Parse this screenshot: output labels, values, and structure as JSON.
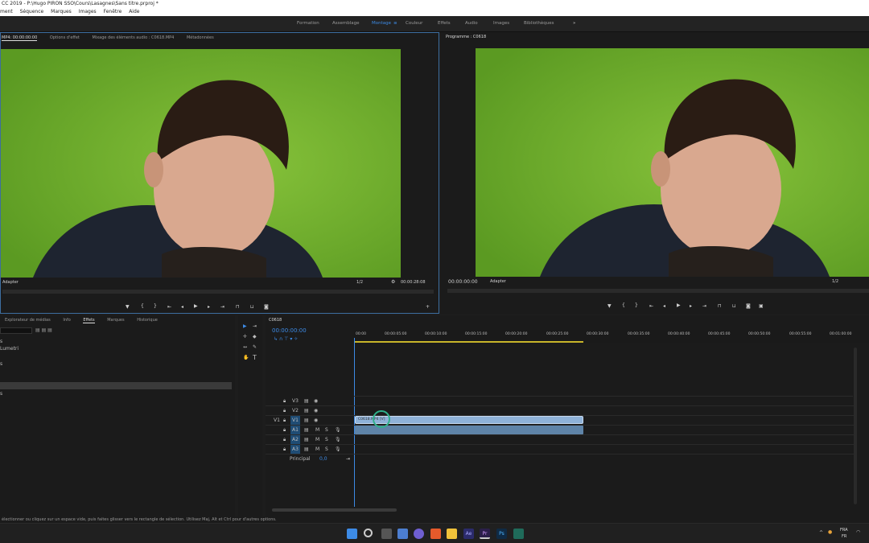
{
  "window": {
    "title": "CC 2019 - P:\\Hugo PIRON SSO\\Cours\\Lasagnes\\Sans titre.prproj *"
  },
  "menu": [
    "ment",
    "Séquence",
    "Marques",
    "Images",
    "Fenêtre",
    "Aide"
  ],
  "workspaces": [
    {
      "label": "Formation"
    },
    {
      "label": "Assemblage"
    },
    {
      "label": "Montage",
      "active": true
    },
    {
      "label": "Couleur"
    },
    {
      "label": "Effets"
    },
    {
      "label": "Audio"
    },
    {
      "label": "Images"
    },
    {
      "label": "Bibliothèques"
    },
    {
      "label": "»"
    }
  ],
  "source_monitor": {
    "tabs": [
      "MP4: 00:00:00:00",
      "Options d'effet",
      "Mixage des éléments audio : C0618.MP4",
      "Métadonnées"
    ],
    "fit": "Adapter",
    "resolution": "1/2",
    "duration": "00:00:28:08"
  },
  "program_monitor": {
    "tab": "Programme : C0618",
    "timecode": "00:00:00:00",
    "fit": "Adapter",
    "resolution": "1/2"
  },
  "project_panel": {
    "tabs": [
      "Explorateur de médias",
      "Info",
      "Effets",
      "Marques",
      "Historique"
    ],
    "list": [
      "s",
      "Lumetri",
      "s",
      "s"
    ]
  },
  "timeline": {
    "tab": "C0618",
    "timecode": "00:00:00:00",
    "ruler": [
      "00:00",
      "00:00:05:00",
      "00:00:10:00",
      "00:00:15:00",
      "00:00:20:00",
      "00:00:25:00",
      "00:00:30:00",
      "00:00:35:00",
      "00:00:40:00",
      "00:00:45:00",
      "00:00:50:00",
      "00:00:55:00",
      "00:01:00:00"
    ],
    "video_tracks": [
      "V3",
      "V2",
      "V1"
    ],
    "audio_tracks": [
      "A1",
      "A2",
      "A3"
    ],
    "source_patch": "V1",
    "clip_name": "C0618.MP4 [V]",
    "master": "Principal",
    "master_value": "0,0",
    "mute_label": "M",
    "solo_label": "S"
  },
  "status": "électionner ou cliquez sur un espace vide, puis faites glisser vers le rectangle de sélection. Utilisez Maj, Alt et Ctrl pour d'autres options.",
  "taskbar": {
    "lang": "FRA",
    "region": "FR"
  }
}
